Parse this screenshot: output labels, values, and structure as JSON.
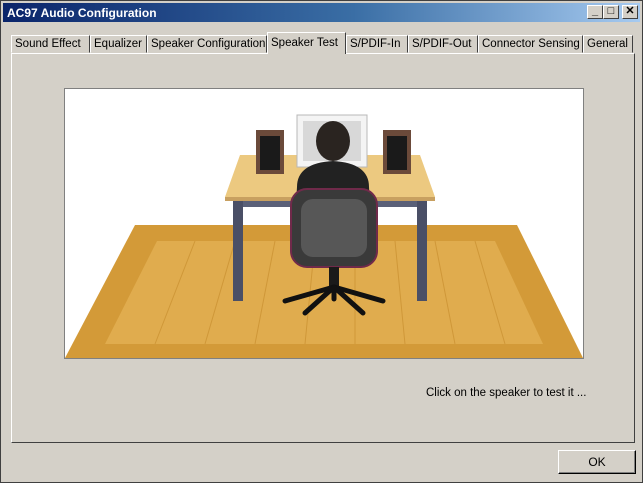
{
  "window": {
    "title": "AC97 Audio Configuration",
    "controls": {
      "minimize": "_",
      "maximize": "□",
      "close": "✕"
    }
  },
  "tabs": [
    {
      "label": "Sound Effect"
    },
    {
      "label": "Equalizer"
    },
    {
      "label": "Speaker Configuration"
    },
    {
      "label": "Speaker Test",
      "selected": true
    },
    {
      "label": "S/PDIF-In"
    },
    {
      "label": "S/PDIF-Out"
    },
    {
      "label": "Connector Sensing"
    },
    {
      "label": "General"
    }
  ],
  "speaker_test": {
    "hint": "Click on the speaker to test it ..."
  },
  "buttons": {
    "ok": "OK"
  },
  "colors": {
    "title_start": "#0a246a",
    "title_end": "#a6caf0",
    "floor": "#d8a03c",
    "desk": "#e8c47c",
    "dialog": "#d4d0c8"
  }
}
